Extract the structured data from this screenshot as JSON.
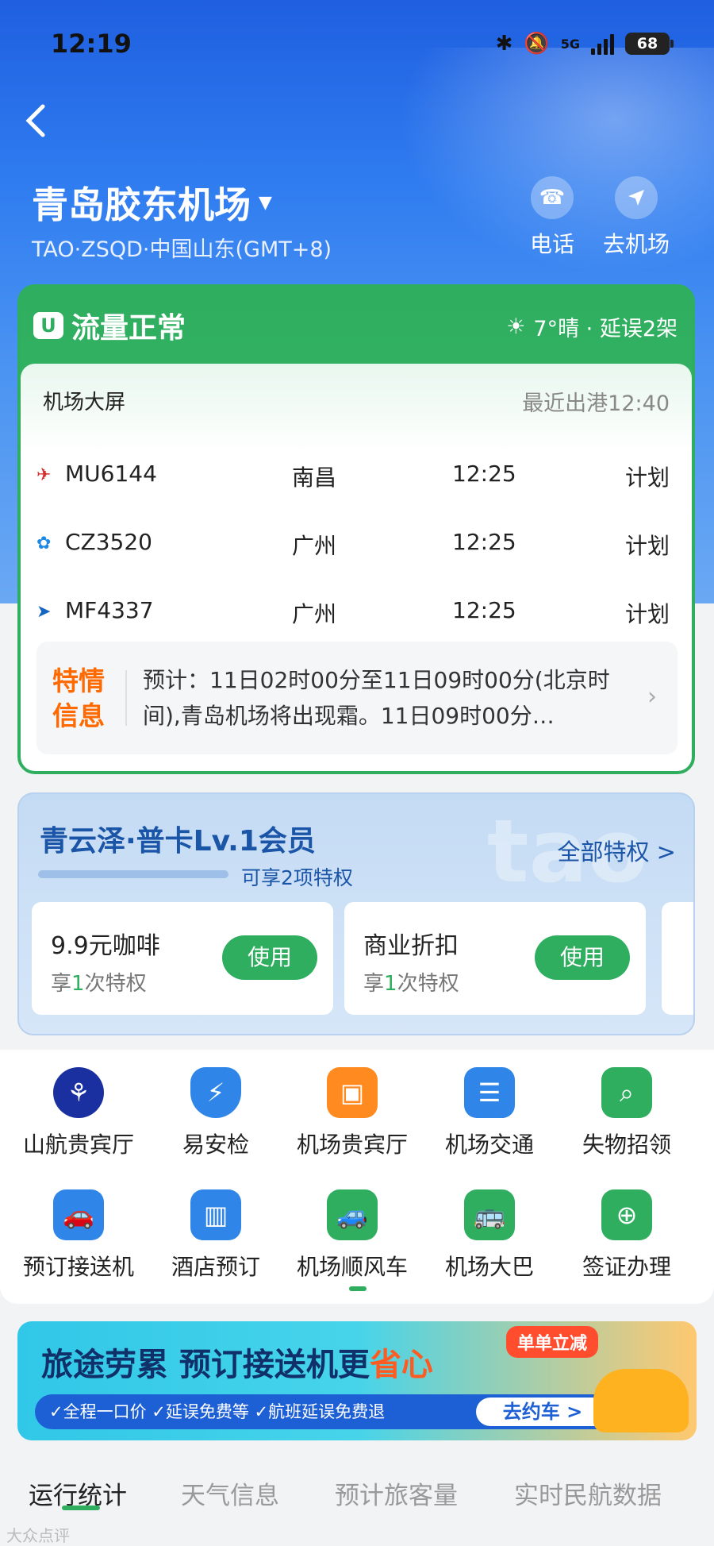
{
  "status_bar": {
    "time": "12:19",
    "network": "5G",
    "battery": "68"
  },
  "header": {
    "airport_name": "青岛胶东机场",
    "airport_sub": "TAO·ZSQD·中国山东(GMT+8)",
    "actions": [
      {
        "label": "电话",
        "icon": "phone-icon"
      },
      {
        "label": "去机场",
        "icon": "navigate-icon"
      }
    ]
  },
  "status_card": {
    "flow": "流量正常",
    "weather": "7°晴 · 延误2架",
    "board_title": "机场大屏",
    "latest": "最近出港12:40",
    "flights": [
      {
        "airline_icon": "china-eastern-icon",
        "flight": "MU6144",
        "dest": "南昌",
        "time": "12:25",
        "status": "计划"
      },
      {
        "airline_icon": "china-southern-icon",
        "flight": "CZ3520",
        "dest": "广州",
        "time": "12:25",
        "status": "计划"
      },
      {
        "airline_icon": "xiamen-air-icon",
        "flight": "MF4337",
        "dest": "广州",
        "time": "12:25",
        "status": "计划"
      }
    ],
    "notice_tag": "特情信息",
    "notice_text": "预计：11日02时00分至11日09时00分(北京时间),青岛机场将出现霜。11日09时00分…"
  },
  "member": {
    "title": "青云泽·普卡Lv.1会员",
    "watermark": "tao",
    "all_label": "全部特权 >",
    "hint": "可享2项特权",
    "privileges": [
      {
        "title": "9.9元咖啡",
        "sub_pre": "享",
        "count": "1",
        "sub_post": "次特权",
        "button": "使用"
      },
      {
        "title": "商业折扣",
        "sub_pre": "享",
        "count": "1",
        "sub_post": "次特权",
        "button": "使用"
      }
    ]
  },
  "services": [
    {
      "label": "山航贵宾厅",
      "icon": "shandong-airlines-icon",
      "color": "#1a2fa0"
    },
    {
      "label": "易安检",
      "icon": "security-shield-icon",
      "color": "#2f86e8"
    },
    {
      "label": "机场贵宾厅",
      "icon": "sofa-icon",
      "color": "#ff8a1f"
    },
    {
      "label": "机场交通",
      "icon": "transport-list-icon",
      "color": "#2f86e8"
    },
    {
      "label": "失物招领",
      "icon": "lost-found-icon",
      "color": "#2fae60"
    },
    {
      "label": "预订接送机",
      "icon": "car-icon",
      "color": "#2f86e8"
    },
    {
      "label": "酒店预订",
      "icon": "hotel-icon",
      "color": "#2f86e8"
    },
    {
      "label": "机场顺风车",
      "icon": "carpool-icon",
      "color": "#2fae60"
    },
    {
      "label": "机场大巴",
      "icon": "bus-icon",
      "color": "#2fae60"
    },
    {
      "label": "签证办理",
      "icon": "visa-icon",
      "color": "#2fae60"
    }
  ],
  "banner": {
    "title_pre": "旅途劳累  预订接送机更",
    "title_hl": "省心",
    "tag": "单单立减",
    "bar": "✓全程一口价  ✓延误免费等  ✓航班延误免费退",
    "go": "去约车 >"
  },
  "tabs": [
    {
      "label": "运行统计",
      "active": true
    },
    {
      "label": "天气信息",
      "active": false
    },
    {
      "label": "预计旅客量",
      "active": false
    },
    {
      "label": "实时民航数据",
      "active": false
    }
  ],
  "watermark_text": "大众点评"
}
